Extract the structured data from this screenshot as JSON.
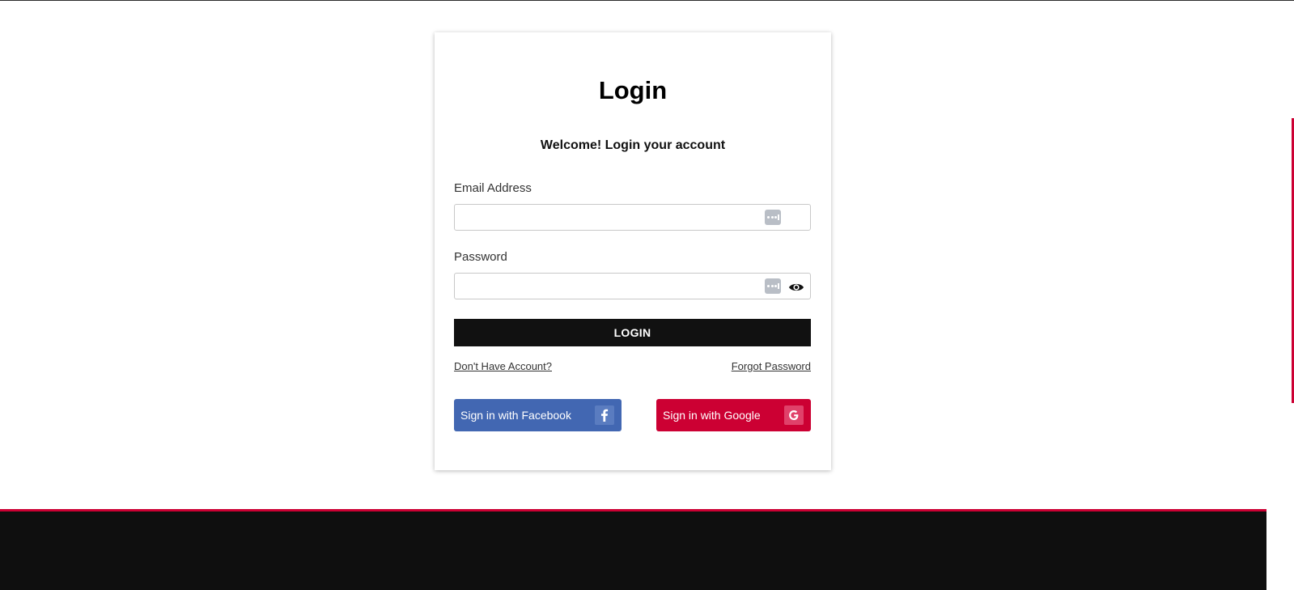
{
  "login": {
    "title": "Login",
    "subtitle": "Welcome! Login your account",
    "email_label": "Email Address",
    "email_value": "",
    "password_label": "Password",
    "password_value": "",
    "submit_label": "LOGIN",
    "signup_link": "Don't Have Account?",
    "forgot_link": "Forgot Password"
  },
  "social": {
    "facebook_label": "Sign in with Facebook",
    "facebook_icon": "facebook-f-icon",
    "google_label": "Sign in with Google",
    "google_icon": "google-g-icon"
  },
  "icons": {
    "autofill": "password-manager-autofill-icon",
    "show_password": "eye-icon"
  },
  "colors": {
    "accent": "#cc0033",
    "primary_button": "#111111",
    "facebook": "#4267b2",
    "google": "#cc0033",
    "footer": "#0f0f0f"
  }
}
